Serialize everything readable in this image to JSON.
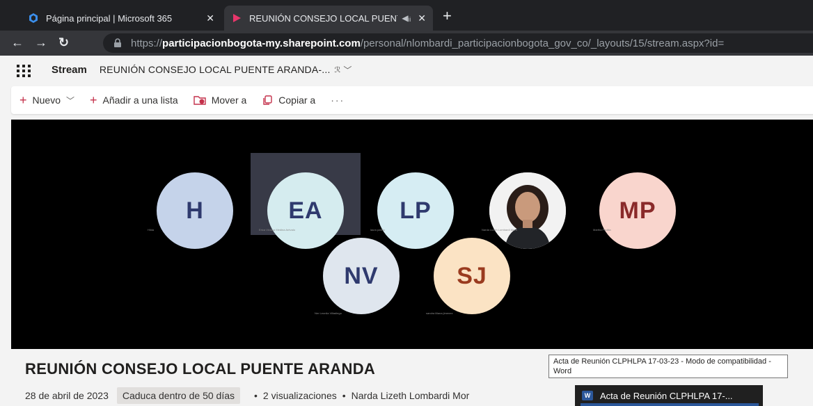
{
  "browser": {
    "tabs": [
      {
        "title": "Página principal | Microsoft 365",
        "active": false
      },
      {
        "title": "REUNIÓN CONSEJO LOCAL PUENTE ARANDA",
        "active": true
      }
    ],
    "new_tab_label": "+",
    "url_scheme": "https://",
    "url_host": "participacionbogota-my.sharepoint.com",
    "url_path": "/personal/nlombardi_participacionbogota_gov_co/_layouts/15/stream.aspx?id="
  },
  "app": {
    "name": "Stream",
    "doc_title": "REUNIÓN CONSEJO LOCAL PUENTE ARANDA-..."
  },
  "commands": {
    "new_label": "Nuevo",
    "add_to_list_label": "Añadir a una lista",
    "move_label": "Mover a",
    "copy_label": "Copiar a",
    "more_label": "···"
  },
  "video": {
    "participants": [
      {
        "initials": "H",
        "name": "Hilda",
        "color": "#c5d3ea"
      },
      {
        "initials": "EA",
        "name": "Erica Viviana Medina Arévalo",
        "color": "#d5ecef"
      },
      {
        "initials": "LP",
        "name": "laura patiño",
        "color": "#d6edf3"
      },
      {
        "initials": "",
        "name": "Narda Lizeth Lombardi Mora",
        "color": "#f2f2f2"
      },
      {
        "initials": "MP",
        "name": "Martha Padilla",
        "color": "#f9d5cd"
      },
      {
        "initials": "NV",
        "name": "Ner Leonila Villadiego",
        "color": "#dfe6ee"
      },
      {
        "initials": "SJ",
        "name": "sandra liliana jimenez",
        "color": "#fbe3c4"
      }
    ]
  },
  "meta": {
    "title": "REUNIÓN CONSEJO LOCAL PUENTE ARANDA",
    "date": "28 de abril de 2023",
    "expiry": "Caduca dentro de 50 días",
    "views": "2 visualizaciones",
    "owner": "Narda Lizeth Lombardi Mor"
  },
  "tooltip": {
    "text": "Acta de Reunión  CLPHLPA  17-03-23  -  Modo de compatibilidad - Word"
  },
  "taskbar_thumb": {
    "label": "Acta de Reunión  CLPHLPA  17-...",
    "icon_letter": "W"
  },
  "colors": {
    "accent": "#c4314b",
    "avatar_text": "#2f3a6e"
  }
}
